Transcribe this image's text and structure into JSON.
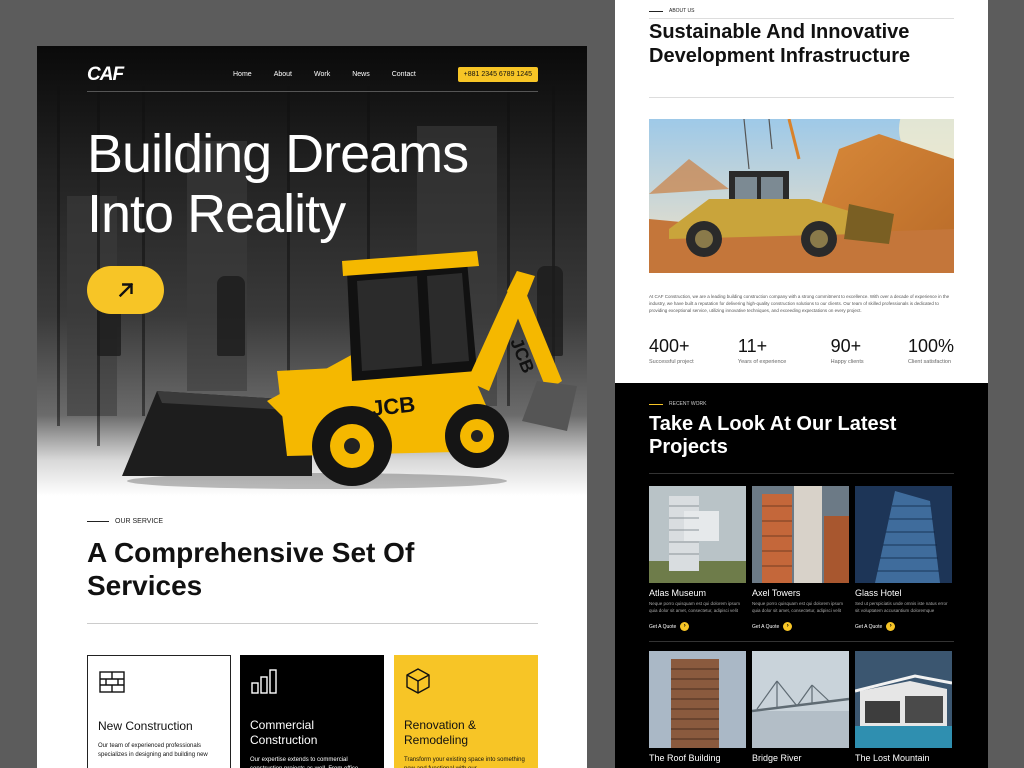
{
  "nav": {
    "logo": "CAF",
    "links": [
      "Home",
      "About",
      "Work",
      "News",
      "Contact"
    ],
    "phone": "+881 2345 6789 1245"
  },
  "hero": {
    "title": "Building Dreams Into Reality",
    "cta_icon": "arrow-up-right-icon"
  },
  "services": {
    "tag": "OUR SERVICE",
    "title": "A Comprehensive Set Of Services",
    "cards": [
      {
        "title": "New Construction",
        "desc": "Our team of experienced professionals specializes in designing and building new",
        "icon": "brick-wall-icon"
      },
      {
        "title": "Commercial Construction",
        "desc": "Our expertise extends to commercial construction projects as well. From office",
        "icon": "bar-chart-icon"
      },
      {
        "title": "Renovation & Remodeling",
        "desc": "Transform your existing space into something new and functional with our",
        "icon": "cube-icon"
      }
    ]
  },
  "about": {
    "tag": "ABOUT US",
    "title": "Sustainable And Innovative Development Infrastructure",
    "text": "At CAF Construction, we are a leading building construction company with a strong commitment to excellence. With over a decade of experience in the industry, we have built a reputation for delivering high-quality construction solutions to our clients. Our team of skilled professionals is dedicated to providing exceptional service, utilizing innovative techniques, and exceeding expectations on every project.",
    "stats": [
      {
        "value": "400+",
        "label": "Successful project"
      },
      {
        "value": "11+",
        "label": "Years of experience"
      },
      {
        "value": "90+",
        "label": "Happy clients"
      },
      {
        "value": "100%",
        "label": "Client satisfaction"
      }
    ]
  },
  "recent": {
    "tag": "RECENT WORK",
    "title": "Take A Look At Our Latest Projects",
    "quote_label": "Get A Quote",
    "projects": [
      {
        "name": "Atlas Museum",
        "desc": "Neque porro quisquam est qui dolorem ipsum quia dolor sit amet, consectetur, adipisci velit"
      },
      {
        "name": "Axel Towers",
        "desc": "Neque porro quisquam est qui dolorem ipsum quia dolor sit amet, consectetur, adipisci velit"
      },
      {
        "name": "Glass Hotel",
        "desc": "Sed ut perspiciatis unde omnis iste natus error sit voluptatem accusantium doloremque"
      },
      {
        "name": "The Roof Building",
        "desc": ""
      },
      {
        "name": "Bridge River",
        "desc": ""
      },
      {
        "name": "The Lost Mountain",
        "desc": ""
      }
    ]
  },
  "colors": {
    "accent": "#f7c526",
    "dark": "#000000",
    "light": "#ffffff"
  }
}
